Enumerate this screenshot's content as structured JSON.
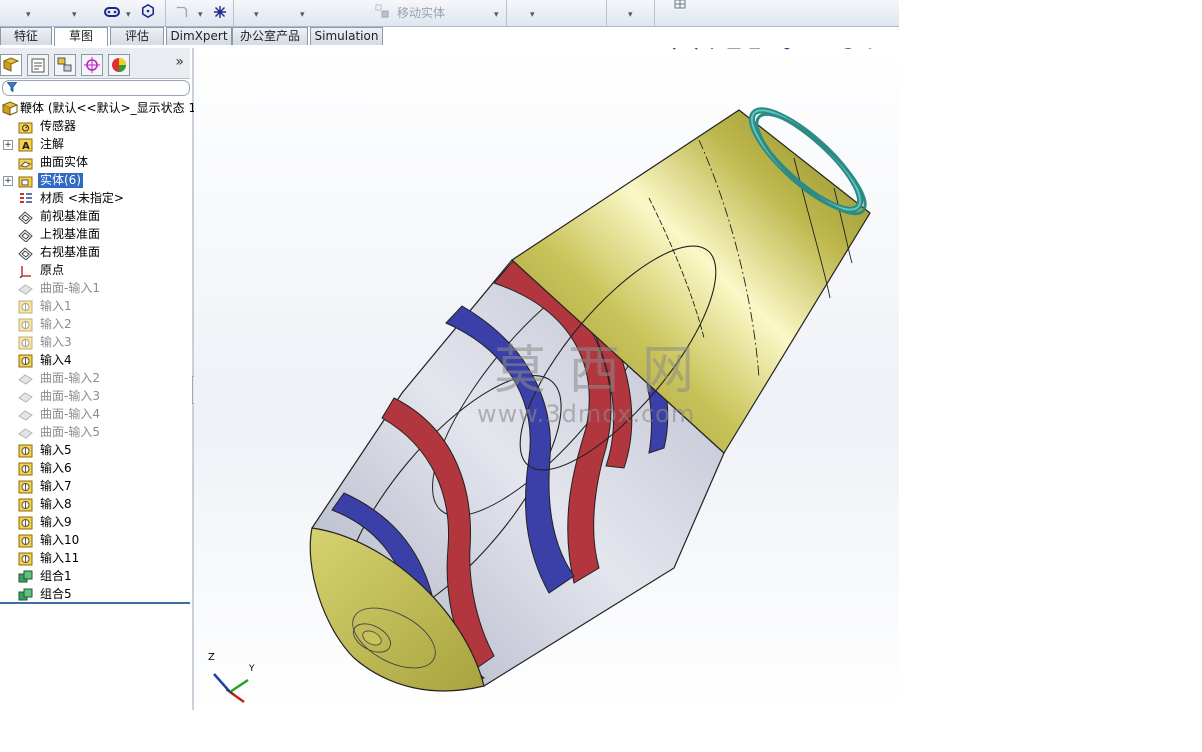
{
  "toolbar": {
    "move_entity_label": "移动实体"
  },
  "tabs": [
    {
      "label": "特征"
    },
    {
      "label": "草图"
    },
    {
      "label": "评估"
    },
    {
      "label": "DimXpert"
    },
    {
      "label": "办公室产品"
    },
    {
      "label": "Simulation"
    }
  ],
  "feature_tree": {
    "root": {
      "label": "鞭体  (默认<<默认>_显示状态 1"
    },
    "items": [
      {
        "label": "传感器",
        "icon": "sensor-folder-icon",
        "state": "normal"
      },
      {
        "label": "注解",
        "icon": "annotation-icon",
        "state": "normal",
        "expander": "+"
      },
      {
        "label": "曲面实体",
        "icon": "surface-bodies-icon",
        "state": "normal"
      },
      {
        "label": "实体(6)",
        "icon": "solid-bodies-icon",
        "state": "selected",
        "expander": "+"
      },
      {
        "label": "材质 <未指定>",
        "icon": "material-icon",
        "state": "normal"
      },
      {
        "label": "前视基准面",
        "icon": "plane-icon",
        "state": "normal"
      },
      {
        "label": "上视基准面",
        "icon": "plane-icon",
        "state": "normal"
      },
      {
        "label": "右视基准面",
        "icon": "plane-icon",
        "state": "normal"
      },
      {
        "label": "原点",
        "icon": "origin-icon",
        "state": "normal"
      },
      {
        "label": "曲面-输入1",
        "icon": "surface-import-icon",
        "state": "suppressed"
      },
      {
        "label": "输入1",
        "icon": "import-body-icon",
        "state": "suppressed"
      },
      {
        "label": "输入2",
        "icon": "import-body-icon",
        "state": "suppressed"
      },
      {
        "label": "输入3",
        "icon": "import-body-icon",
        "state": "suppressed"
      },
      {
        "label": "输入4",
        "icon": "import-body-icon",
        "state": "normal"
      },
      {
        "label": "曲面-输入2",
        "icon": "surface-import-icon",
        "state": "suppressed"
      },
      {
        "label": "曲面-输入3",
        "icon": "surface-import-icon",
        "state": "suppressed"
      },
      {
        "label": "曲面-输入4",
        "icon": "surface-import-icon",
        "state": "suppressed"
      },
      {
        "label": "曲面-输入5",
        "icon": "surface-import-icon",
        "state": "suppressed"
      },
      {
        "label": "输入5",
        "icon": "import-body-icon",
        "state": "normal"
      },
      {
        "label": "输入6",
        "icon": "import-body-icon",
        "state": "normal"
      },
      {
        "label": "输入7",
        "icon": "import-body-icon",
        "state": "normal"
      },
      {
        "label": "输入8",
        "icon": "import-body-icon",
        "state": "normal"
      },
      {
        "label": "输入9",
        "icon": "import-body-icon",
        "state": "normal"
      },
      {
        "label": "输入10",
        "icon": "import-body-icon",
        "state": "normal"
      },
      {
        "label": "输入11",
        "icon": "import-body-icon",
        "state": "normal"
      },
      {
        "label": "组合1",
        "icon": "combine-icon",
        "state": "normal"
      },
      {
        "label": "组合5",
        "icon": "combine-icon",
        "state": "normal"
      }
    ]
  },
  "viewport": {
    "watermark_text": "莫西网",
    "watermark_url": "www.3dmox.com",
    "triad": {
      "z": "Z",
      "y": "Y"
    }
  },
  "colors": {
    "selection": "#316ac5",
    "body_gold": "#b5b24a",
    "body_grey": "#c4c8d6",
    "blade_red": "#b2363e",
    "blade_blue": "#3b3fa8",
    "rim_teal": "#3aa7a0"
  }
}
